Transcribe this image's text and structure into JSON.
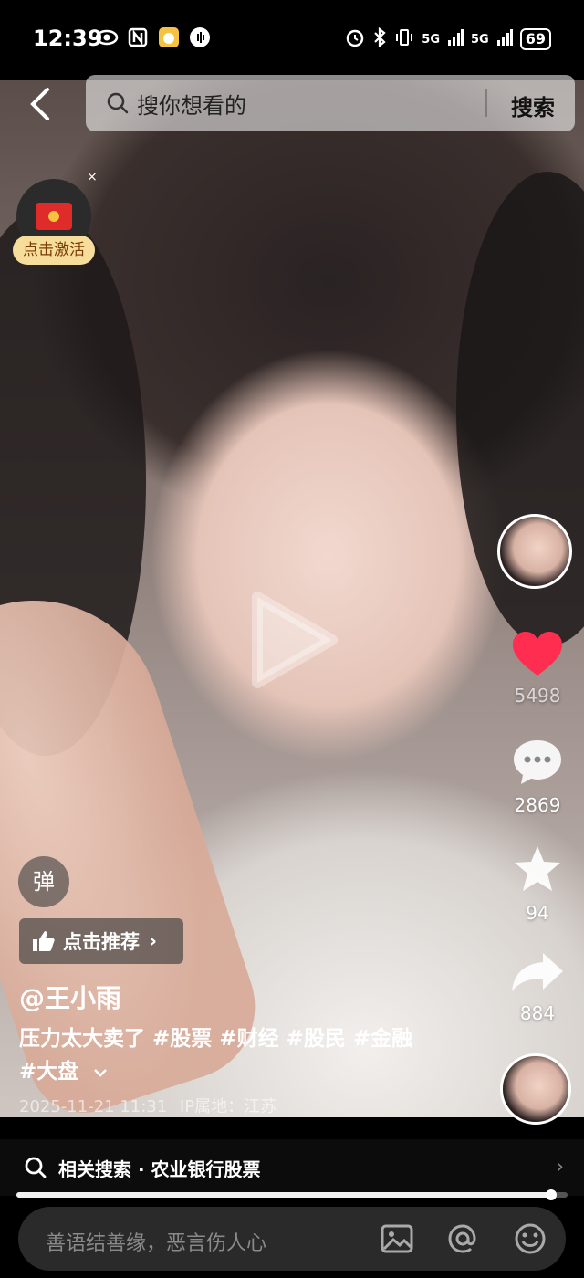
{
  "status_bar": {
    "time": "12:39",
    "signal_1": "5G",
    "signal_2": "5G",
    "battery": "69"
  },
  "search": {
    "placeholder": "搜你想看的",
    "button": "搜索"
  },
  "activation": {
    "label": "点击激活",
    "close": "×"
  },
  "rail": {
    "likes": "5498",
    "comments": "2869",
    "favorites": "94",
    "shares": "884"
  },
  "danmu": {
    "label": "弹"
  },
  "recommend": {
    "label": "点击推荐"
  },
  "post": {
    "author": "@王小雨",
    "caption_text": "压力太大卖了",
    "tags": [
      "#股票",
      "#财经",
      "#股民",
      "#金融",
      "#大盘"
    ],
    "timestamp": "2025-11-21 11:31",
    "ip_location": "IP属地：江苏"
  },
  "related": {
    "label": "相关搜索 · 农业银行股票"
  },
  "playback": {
    "progress": 0.97
  },
  "comment": {
    "placeholder": "善语结善缘，恶言伤人心"
  }
}
